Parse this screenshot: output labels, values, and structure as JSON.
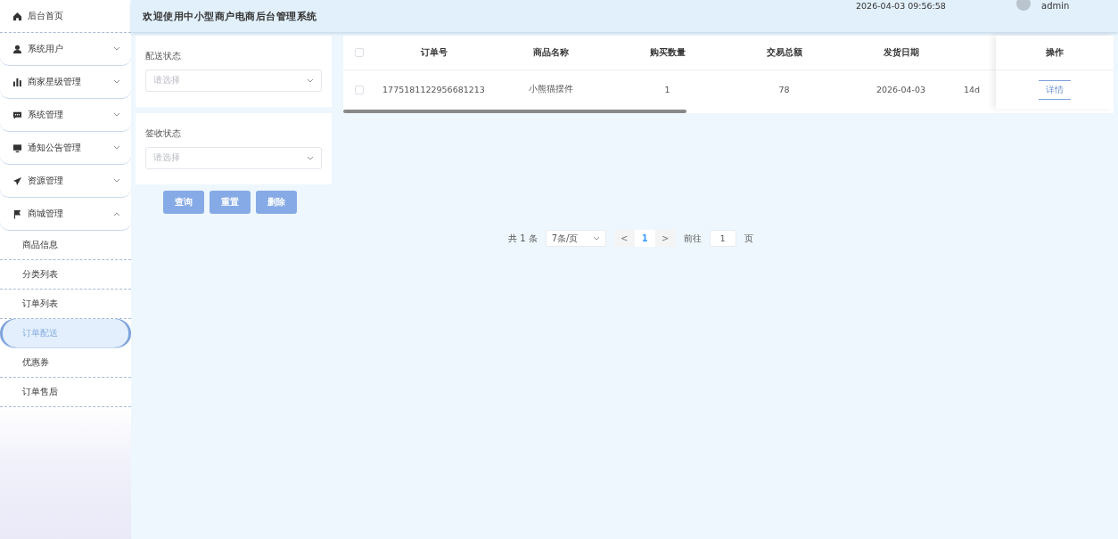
{
  "sidebar": {
    "items": [
      {
        "kind": "link",
        "label": "后台首页"
      },
      {
        "kind": "submenu",
        "label": "系统用户",
        "expanded": false
      },
      {
        "kind": "submenu",
        "label": "商家星级管理",
        "expanded": false
      },
      {
        "kind": "submenu",
        "label": "系统管理",
        "expanded": false
      },
      {
        "kind": "submenu",
        "label": "通知公告管理",
        "expanded": false
      },
      {
        "kind": "submenu",
        "label": "资源管理",
        "expanded": false
      },
      {
        "kind": "submenu",
        "label": "商城管理",
        "expanded": true,
        "children": [
          {
            "label": "商品信息",
            "selected": false
          },
          {
            "label": "分类列表",
            "selected": false
          },
          {
            "label": "订单列表",
            "selected": false
          },
          {
            "label": "订单配送",
            "selected": true
          },
          {
            "label": "优惠券",
            "selected": false
          },
          {
            "label": "订单售后",
            "selected": false
          }
        ]
      }
    ]
  },
  "header": {
    "title": "欢迎使用中小型商户电商后台管理系统",
    "datetime": "2026-04-03 09:56:58",
    "user": "admin"
  },
  "filters": [
    {
      "label": "配送状态",
      "placeholder": "请选择"
    },
    {
      "label": "签收状态",
      "placeholder": "请选择"
    }
  ],
  "buttons": [
    "查询",
    "重置",
    "删除"
  ],
  "table": {
    "columns": [
      "订单号",
      "商品名称",
      "购买数量",
      "交易总额",
      "发货日期"
    ],
    "fixed_column": "操作",
    "all_checked": false,
    "rows": [
      {
        "checked": false,
        "cells": [
          "1775181122956681213",
          "小熊猫摆件",
          "1",
          "78",
          "2026-04-03"
        ],
        "column_7": "14d",
        "action": "详情"
      }
    ]
  },
  "pagination": {
    "total": "共 1 条",
    "page_size": "7条/页",
    "prev": "<",
    "pages": [
      {
        "label": "1",
        "selected": true
      }
    ],
    "next": ">",
    "goto_label": "前往",
    "goto_value": "1",
    "goto_unit": "页"
  }
}
